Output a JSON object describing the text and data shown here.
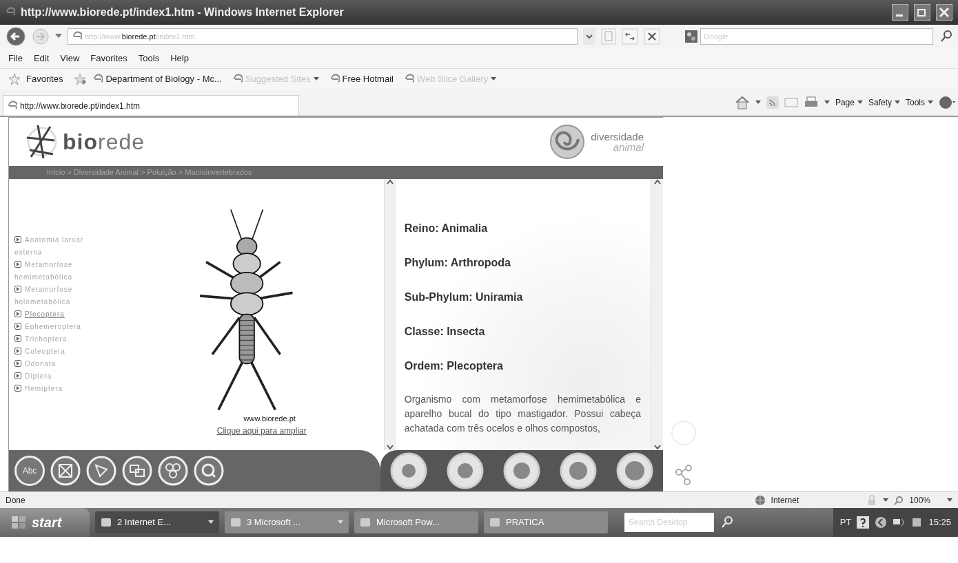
{
  "window": {
    "title": "http://www.biorede.pt/index1.htm - Windows Internet Explorer"
  },
  "address_bar": {
    "prefix": "http://www.",
    "host": "biorede.pt",
    "path": "/index1.htm"
  },
  "search": {
    "placeholder": "Google"
  },
  "menu": [
    "File",
    "Edit",
    "View",
    "Favorites",
    "Tools",
    "Help"
  ],
  "favorites_bar": {
    "label": "Favorites",
    "items": [
      {
        "label": "Department of Biology - Mc...",
        "dimmed": false,
        "dropdown": false
      },
      {
        "label": "Suggested Sites",
        "dimmed": true,
        "dropdown": true
      },
      {
        "label": "Free Hotmail",
        "dimmed": false,
        "dropdown": false
      },
      {
        "label": "Web Slice Gallery",
        "dimmed": true,
        "dropdown": true
      }
    ]
  },
  "tab": {
    "title": "http://www.biorede.pt/index1.htm"
  },
  "command_bar": [
    "Page",
    "Safety",
    "Tools"
  ],
  "page": {
    "logo": "**bio**rede",
    "brand": {
      "line1": "diversidade",
      "line2": "animal"
    },
    "breadcrumb": "Início > Diversidade Animal > Poluição > Macroinvertebrados",
    "nav": [
      {
        "label": "Anatomia larvar externa",
        "selected": false
      },
      {
        "label": "Metamorfose hemimetabólica",
        "selected": false
      },
      {
        "label": "Metamorfose holometabólica",
        "selected": false
      },
      {
        "label": "Plecoptera",
        "selected": true
      },
      {
        "label": "Ephemeroptera",
        "selected": false
      },
      {
        "label": "Trichoptera",
        "selected": false
      },
      {
        "label": "Coleoptera",
        "selected": false
      },
      {
        "label": "Odonata",
        "selected": false
      },
      {
        "label": "Diptera",
        "selected": false
      },
      {
        "label": "Hemiptera",
        "selected": false
      }
    ],
    "image_credit": "www.biorede.pt",
    "enlarge_link": "Clique aqui para ampliar",
    "taxonomy": [
      "Reino: Animalia",
      "Phylum: Arthropoda",
      "Sub-Phylum: Uniramia",
      "Classe: Insecta",
      "Ordem: Plecoptera"
    ],
    "description": "Organismo com metamorfose hemimetabólica e aparelho bucal do tipo mastigador. Possui cabeça achatada com três ocelos e olhos compostos,",
    "tool_icons": [
      "Abc"
    ]
  },
  "status_bar": {
    "text": "Done",
    "zone": "Internet",
    "zoom": "100%"
  },
  "taskbar": {
    "start": "start",
    "buttons": [
      {
        "label": "2 Internet E...",
        "selected": true,
        "group": true
      },
      {
        "label": "3 Microsoft ...",
        "selected": false,
        "group": true
      },
      {
        "label": "Microsoft Pow...",
        "selected": false,
        "group": false
      },
      {
        "label": "PRATICA",
        "selected": false,
        "group": false
      }
    ],
    "search_placeholder": "Search Desktop",
    "language": "PT",
    "time": "15:25"
  }
}
